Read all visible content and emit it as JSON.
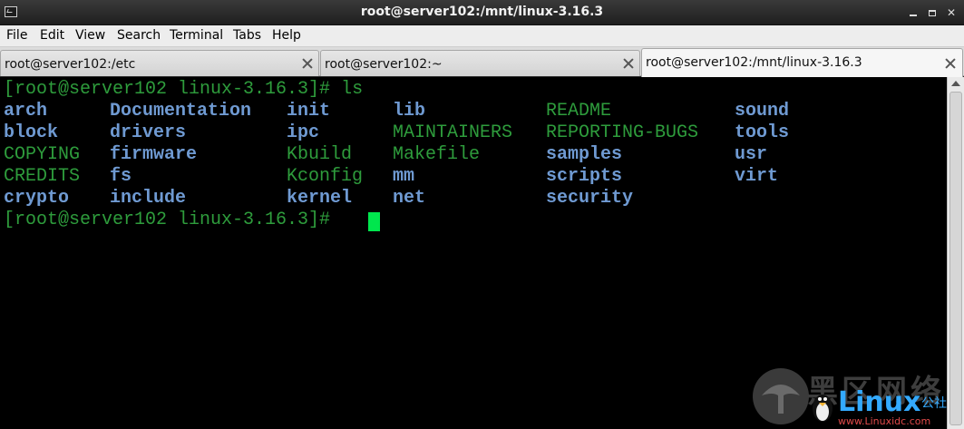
{
  "window": {
    "title": "root@server102:/mnt/linux-3.16.3"
  },
  "menu": [
    "File",
    "Edit",
    "View",
    "Search",
    "Terminal",
    "Tabs",
    "Help"
  ],
  "tabs": [
    {
      "label": "root@server102:/etc",
      "active": false
    },
    {
      "label": "root@server102:~",
      "active": false
    },
    {
      "label": "root@server102:/mnt/linux-3.16.3",
      "active": true
    }
  ],
  "terminal": {
    "prompt": "[root@server102 linux-3.16.3]#",
    "command": "ls",
    "columns": [
      [
        {
          "name": "arch",
          "type": "dir"
        },
        {
          "name": "block",
          "type": "dir"
        },
        {
          "name": "COPYING",
          "type": "file"
        },
        {
          "name": "CREDITS",
          "type": "file"
        },
        {
          "name": "crypto",
          "type": "dir"
        }
      ],
      [
        {
          "name": "Documentation",
          "type": "dir"
        },
        {
          "name": "drivers",
          "type": "dir"
        },
        {
          "name": "firmware",
          "type": "dir"
        },
        {
          "name": "fs",
          "type": "dir"
        },
        {
          "name": "include",
          "type": "dir"
        }
      ],
      [
        {
          "name": "init",
          "type": "dir"
        },
        {
          "name": "ipc",
          "type": "dir"
        },
        {
          "name": "Kbuild",
          "type": "file"
        },
        {
          "name": "Kconfig",
          "type": "file"
        },
        {
          "name": "kernel",
          "type": "dir"
        }
      ],
      [
        {
          "name": "lib",
          "type": "dir"
        },
        {
          "name": "MAINTAINERS",
          "type": "file"
        },
        {
          "name": "Makefile",
          "type": "file"
        },
        {
          "name": "mm",
          "type": "dir"
        },
        {
          "name": "net",
          "type": "dir"
        }
      ],
      [
        {
          "name": "README",
          "type": "file"
        },
        {
          "name": "REPORTING-BUGS",
          "type": "file"
        },
        {
          "name": "samples",
          "type": "dir"
        },
        {
          "name": "scripts",
          "type": "dir"
        },
        {
          "name": "security",
          "type": "dir"
        }
      ],
      [
        {
          "name": "sound",
          "type": "dir"
        },
        {
          "name": "tools",
          "type": "dir"
        },
        {
          "name": "usr",
          "type": "dir"
        },
        {
          "name": "virt",
          "type": "dir"
        }
      ]
    ],
    "colors": {
      "background": "#000000",
      "directory": "#6f9ad2",
      "file": "#2e9c3c",
      "cursor": "#00e64d"
    }
  },
  "watermark": {
    "chinese": "黑区网络",
    "brand": "Linux",
    "brand_suffix": "公社",
    "url": "www.Linuxidc.com"
  }
}
